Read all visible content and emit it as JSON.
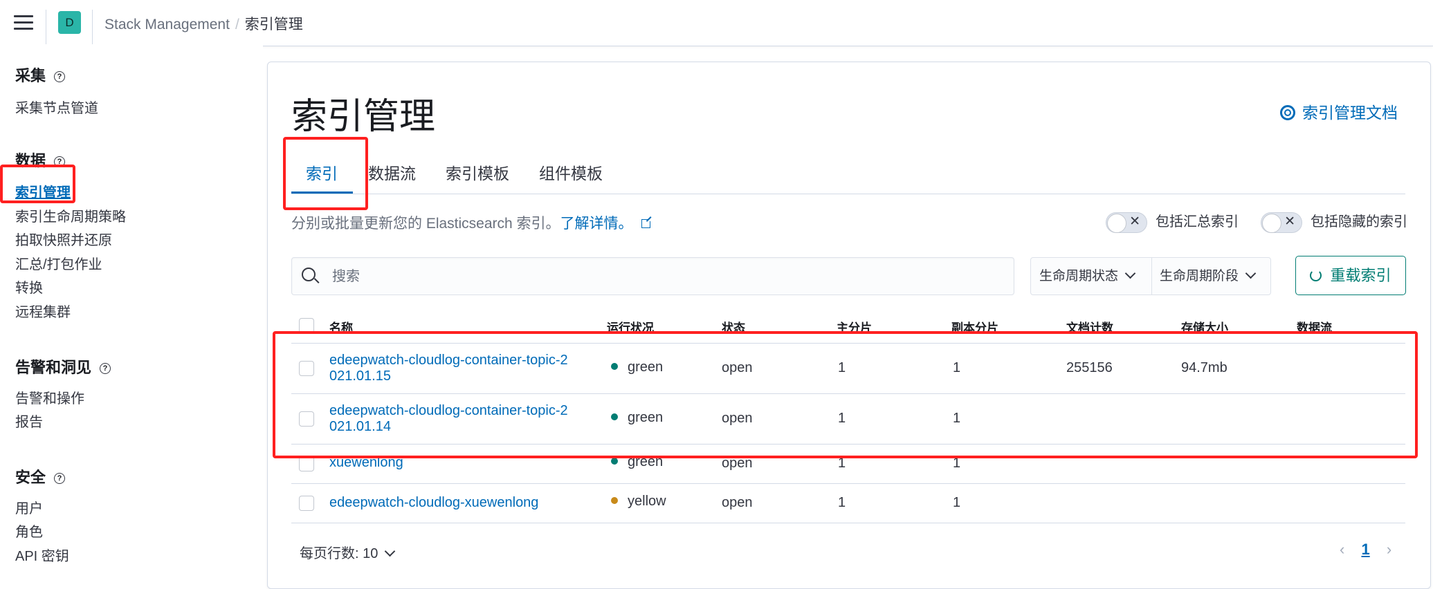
{
  "header": {
    "space_initial": "D",
    "breadcrumb": {
      "parent": "Stack Management",
      "separator": "/",
      "current": "索引管理"
    }
  },
  "sidebar": {
    "groups": [
      {
        "title": "采集",
        "items": [
          "采集节点管道"
        ]
      },
      {
        "title": "数据",
        "items": [
          "索引管理",
          "索引生命周期策略",
          "拍取快照并还原",
          "汇总/打包作业",
          "转换",
          "远程集群"
        ]
      },
      {
        "title": "告警和洞见",
        "items": [
          "告警和操作",
          "报告"
        ]
      },
      {
        "title": "安全",
        "items": [
          "用户",
          "角色",
          "API 密钥"
        ]
      }
    ],
    "help_glyph": "?"
  },
  "main": {
    "title": "索引管理",
    "doc_link": "索引管理文档",
    "tabs": [
      "索引",
      "数据流",
      "索引模板",
      "组件模板"
    ],
    "active_tab": "索引",
    "description": "分别或批量更新您的 Elasticsearch 索引。",
    "learn_more": "了解详情。",
    "toggles": [
      "包括汇总索引",
      "包括隐藏的索引"
    ],
    "search_placeholder": "搜索",
    "filters": [
      "生命周期状态",
      "生命周期阶段"
    ],
    "reload_label": "重载索引"
  },
  "table": {
    "columns": [
      "名称",
      "运行状况",
      "状态",
      "主分片",
      "副本分片",
      "文档计数",
      "存储大小",
      "数据流"
    ],
    "rows": [
      {
        "name_line1": "edeepwatch-cloudlog-container-topic-2",
        "name_line2": "021.01.15",
        "health": "green",
        "status": "open",
        "primary": "1",
        "replicas": "1",
        "docs": "255156",
        "size": "94.7mb"
      },
      {
        "name_line1": "edeepwatch-cloudlog-container-topic-2",
        "name_line2": "021.01.14",
        "health": "green",
        "status": "open",
        "primary": "1",
        "replicas": "1",
        "docs": "",
        "size": ""
      },
      {
        "name_line1": "xuewenlong",
        "name_line2": "",
        "health": "green",
        "status": "open",
        "primary": "1",
        "replicas": "1",
        "docs": "",
        "size": ""
      },
      {
        "name_line1": "edeepwatch-cloudlog-xuewenlong",
        "name_line2": "",
        "health": "yellow",
        "status": "open",
        "primary": "1",
        "replicas": "1",
        "docs": "",
        "size": ""
      }
    ],
    "rows_per_page": "每页行数: 10",
    "current_page": "1"
  },
  "colors": {
    "link": "#006bb8",
    "health_green": "#017d73",
    "health_yellow": "#c88a1a",
    "annotation_red": "#ff2020",
    "primary_button": "#017d73"
  }
}
